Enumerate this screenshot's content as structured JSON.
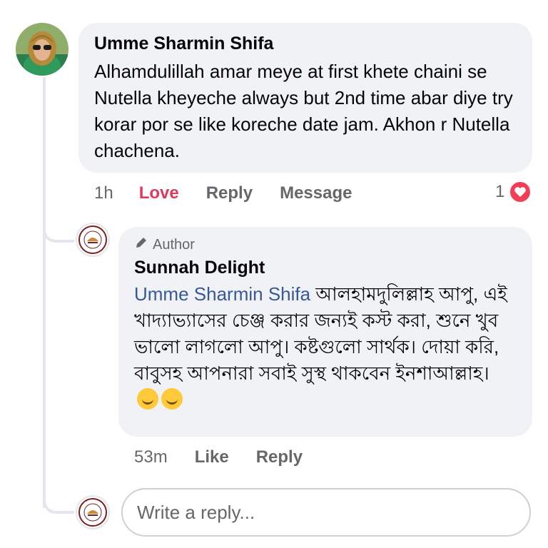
{
  "comment": {
    "author": "Umme Sharmin Shifa",
    "text": "Alhamdulillah amar meye at first khete chaini se Nutella kheyeche always but 2nd time abar diye try korar por se like koreche date jam. Akhon r Nutella chachena.",
    "time": "1h",
    "love_label": "Love",
    "reply_label": "Reply",
    "message_label": "Message",
    "reaction_count": "1"
  },
  "reply": {
    "badge": "Author",
    "author": "Sunnah Delight",
    "mention": "Umme Sharmin Shifa",
    "text": "আলহামদুলিল্লাহ আপু, এই খাদ্যাভ্যাসের চেঞ্জ করার জন্যই কস্ট করা, শুনে খুব ভালো লাগলো আপু। কষ্টগুলো সার্থক।  দোয়া করি, বাবুসহ আপনারা সবাই সুস্থ থাকবেন ইনশাআল্লাহ।",
    "time": "53m",
    "like_label": "Like",
    "reply_label": "Reply"
  },
  "composer": {
    "placeholder": "Write a reply..."
  },
  "colors": {
    "love": "#e0395c",
    "mention": "#385898",
    "bubble": "#f0f2f5"
  }
}
